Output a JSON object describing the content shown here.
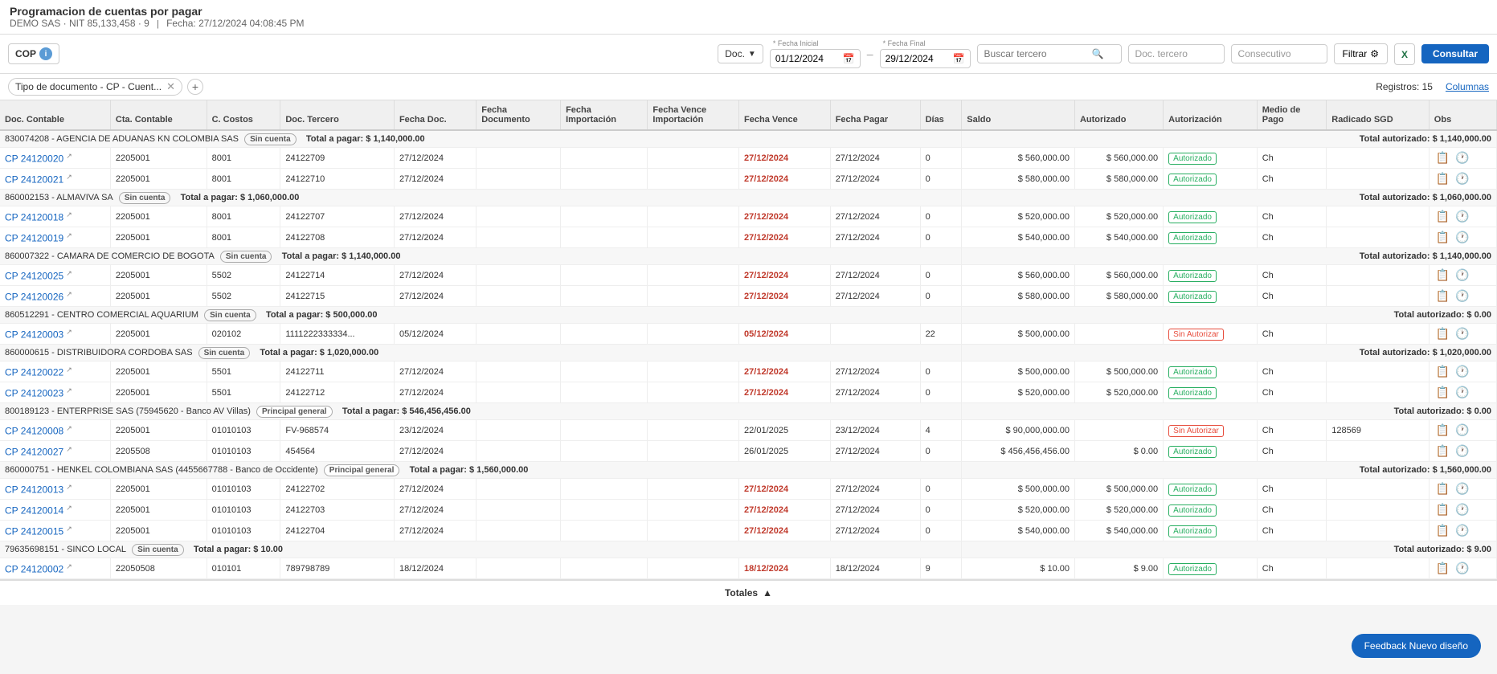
{
  "header": {
    "title": "Programacion de cuentas por pagar",
    "subtitle": "DEMO SAS · NIT 85,133,458 · 9",
    "date_info": "Fecha: 27/12/2024 04:08:45 PM"
  },
  "toolbar": {
    "currency": "COP",
    "doc_label": "Doc.",
    "fecha_inicial_label": "* Fecha Inicial",
    "fecha_inicial": "01/12/2024",
    "fecha_final_label": "* Fecha Final",
    "fecha_final": "29/12/2024",
    "buscar_placeholder": "Buscar tercero",
    "doc_tercero_placeholder": "Doc. tercero",
    "consecutivo_placeholder": "Consecutivo",
    "btn_filtrar": "Filtrar",
    "btn_consultar": "Consultar"
  },
  "filter_bar": {
    "tag": "Tipo de documento - CP - Cuent...",
    "registros": "Registros: 15",
    "btn_columnas": "Columnas"
  },
  "columns": [
    "Doc. Contable",
    "Cta. Contable",
    "C. Costos",
    "Doc. Tercero",
    "Fecha Doc.",
    "Fecha Documento",
    "Fecha Importación",
    "Fecha Vence Importación",
    "Fecha Vence",
    "Fecha Pagar",
    "Días",
    "Saldo",
    "Autorizado",
    "Autorización",
    "Medio de Pago",
    "Radicado SGD",
    "Obs"
  ],
  "groups": [
    {
      "id": "g1",
      "label": "830074208 - AGENCIA DE ADUANAS KN COLOMBIA SAS",
      "badge": "Sin cuenta",
      "total_pagar": "Total a pagar: $ 1,140,000.00",
      "total_autorizado": "Total autorizado: $ 1,140,000.00",
      "rows": [
        {
          "doc_contable": "CP 24120020",
          "cta_contable": "2205001",
          "c_costos": "8001",
          "doc_tercero": "24122709",
          "fecha_doc": "27/12/2024",
          "fecha_documento": "",
          "fecha_importacion": "",
          "fecha_vence_importacion": "",
          "fecha_vence": "27/12/2024",
          "fecha_vence_red": true,
          "fecha_pagar": "27/12/2024",
          "dias": "0",
          "saldo": "$ 560,000.00",
          "autorizado": "$ 560,000.00",
          "autorizacion": "Autorizado",
          "medio_pago": "Ch",
          "radicado_sgd": "",
          "obs": ""
        },
        {
          "doc_contable": "CP 24120021",
          "cta_contable": "2205001",
          "c_costos": "8001",
          "doc_tercero": "24122710",
          "fecha_doc": "27/12/2024",
          "fecha_documento": "",
          "fecha_importacion": "",
          "fecha_vence_importacion": "",
          "fecha_vence": "27/12/2024",
          "fecha_vence_red": true,
          "fecha_pagar": "27/12/2024",
          "dias": "0",
          "saldo": "$ 580,000.00",
          "autorizado": "$ 580,000.00",
          "autorizacion": "Autorizado",
          "medio_pago": "Ch",
          "radicado_sgd": "",
          "obs": ""
        }
      ]
    },
    {
      "id": "g2",
      "label": "860002153 - ALMAVIVA SA",
      "badge": "Sin cuenta",
      "total_pagar": "Total a pagar: $ 1,060,000.00",
      "total_autorizado": "Total autorizado: $ 1,060,000.00",
      "rows": [
        {
          "doc_contable": "CP 24120018",
          "cta_contable": "2205001",
          "c_costos": "8001",
          "doc_tercero": "24122707",
          "fecha_doc": "27/12/2024",
          "fecha_documento": "",
          "fecha_importacion": "",
          "fecha_vence_importacion": "",
          "fecha_vence": "27/12/2024",
          "fecha_vence_red": true,
          "fecha_pagar": "27/12/2024",
          "dias": "0",
          "saldo": "$ 520,000.00",
          "autorizado": "$ 520,000.00",
          "autorizacion": "Autorizado",
          "medio_pago": "Ch",
          "radicado_sgd": "",
          "obs": ""
        },
        {
          "doc_contable": "CP 24120019",
          "cta_contable": "2205001",
          "c_costos": "8001",
          "doc_tercero": "24122708",
          "fecha_doc": "27/12/2024",
          "fecha_documento": "",
          "fecha_importacion": "",
          "fecha_vence_importacion": "",
          "fecha_vence": "27/12/2024",
          "fecha_vence_red": true,
          "fecha_pagar": "27/12/2024",
          "dias": "0",
          "saldo": "$ 540,000.00",
          "autorizado": "$ 540,000.00",
          "autorizacion": "Autorizado",
          "medio_pago": "Ch",
          "radicado_sgd": "",
          "obs": ""
        }
      ]
    },
    {
      "id": "g3",
      "label": "860007322 - CAMARA DE COMERCIO DE BOGOTA",
      "badge": "Sin cuenta",
      "total_pagar": "Total a pagar: $ 1,140,000.00",
      "total_autorizado": "Total autorizado: $ 1,140,000.00",
      "rows": [
        {
          "doc_contable": "CP 24120025",
          "cta_contable": "2205001",
          "c_costos": "5502",
          "doc_tercero": "24122714",
          "fecha_doc": "27/12/2024",
          "fecha_documento": "",
          "fecha_importacion": "",
          "fecha_vence_importacion": "",
          "fecha_vence": "27/12/2024",
          "fecha_vence_red": true,
          "fecha_pagar": "27/12/2024",
          "dias": "0",
          "saldo": "$ 560,000.00",
          "autorizado": "$ 560,000.00",
          "autorizacion": "Autorizado",
          "medio_pago": "Ch",
          "radicado_sgd": "",
          "obs": ""
        },
        {
          "doc_contable": "CP 24120026",
          "cta_contable": "2205001",
          "c_costos": "5502",
          "doc_tercero": "24122715",
          "fecha_doc": "27/12/2024",
          "fecha_documento": "",
          "fecha_importacion": "",
          "fecha_vence_importacion": "",
          "fecha_vence": "27/12/2024",
          "fecha_vence_red": true,
          "fecha_pagar": "27/12/2024",
          "dias": "0",
          "saldo": "$ 580,000.00",
          "autorizado": "$ 580,000.00",
          "autorizacion": "Autorizado",
          "medio_pago": "Ch",
          "radicado_sgd": "",
          "obs": ""
        }
      ]
    },
    {
      "id": "g4",
      "label": "860512291 - CENTRO COMERCIAL AQUARIUM",
      "badge": "Sin cuenta",
      "total_pagar": "Total a pagar: $ 500,000.00",
      "total_autorizado": "Total autorizado: $ 0.00",
      "rows": [
        {
          "doc_contable": "CP 24120003",
          "cta_contable": "2205001",
          "c_costos": "020102",
          "doc_tercero": "1111222333334...",
          "fecha_doc": "05/12/2024",
          "fecha_documento": "",
          "fecha_importacion": "",
          "fecha_vence_importacion": "",
          "fecha_vence": "05/12/2024",
          "fecha_vence_red": true,
          "fecha_pagar": "",
          "dias": "22",
          "saldo": "$ 500,000.00",
          "autorizado": "",
          "autorizacion": "Sin Autorizar",
          "medio_pago": "Ch",
          "radicado_sgd": "",
          "obs": ""
        }
      ]
    },
    {
      "id": "g5",
      "label": "860000615 - DISTRIBUIDORA CORDOBA SAS",
      "badge": "Sin cuenta",
      "total_pagar": "Total a pagar: $ 1,020,000.00",
      "total_autorizado": "Total autorizado: $ 1,020,000.00",
      "rows": [
        {
          "doc_contable": "CP 24120022",
          "cta_contable": "2205001",
          "c_costos": "5501",
          "doc_tercero": "24122711",
          "fecha_doc": "27/12/2024",
          "fecha_documento": "",
          "fecha_importacion": "",
          "fecha_vence_importacion": "",
          "fecha_vence": "27/12/2024",
          "fecha_vence_red": true,
          "fecha_pagar": "27/12/2024",
          "dias": "0",
          "saldo": "$ 500,000.00",
          "autorizado": "$ 500,000.00",
          "autorizacion": "Autorizado",
          "medio_pago": "Ch",
          "radicado_sgd": "",
          "obs": ""
        },
        {
          "doc_contable": "CP 24120023",
          "cta_contable": "2205001",
          "c_costos": "5501",
          "doc_tercero": "24122712",
          "fecha_doc": "27/12/2024",
          "fecha_documento": "",
          "fecha_importacion": "",
          "fecha_vence_importacion": "",
          "fecha_vence": "27/12/2024",
          "fecha_vence_red": true,
          "fecha_pagar": "27/12/2024",
          "dias": "0",
          "saldo": "$ 520,000.00",
          "autorizado": "$ 520,000.00",
          "autorizacion": "Autorizado",
          "medio_pago": "Ch",
          "radicado_sgd": "",
          "obs": ""
        }
      ]
    },
    {
      "id": "g6",
      "label": "800189123 - ENTERPRISE SAS (75945620 - Banco AV Villas)",
      "badge": "Principal general",
      "total_pagar": "Total a pagar: $ 546,456,456.00",
      "total_autorizado": "Total autorizado: $ 0.00",
      "rows": [
        {
          "doc_contable": "CP 24120008",
          "cta_contable": "2205001",
          "c_costos": "01010103",
          "doc_tercero": "FV-968574",
          "fecha_doc": "23/12/2024",
          "fecha_documento": "",
          "fecha_importacion": "",
          "fecha_vence_importacion": "",
          "fecha_vence": "22/01/2025",
          "fecha_vence_red": false,
          "fecha_pagar": "23/12/2024",
          "dias": "4",
          "saldo": "$ 90,000,000.00",
          "autorizado": "",
          "autorizacion": "Sin Autorizar",
          "medio_pago": "Ch",
          "radicado_sgd": "128569",
          "obs": ""
        },
        {
          "doc_contable": "CP 24120027",
          "cta_contable": "2205508",
          "c_costos": "01010103",
          "doc_tercero": "454564",
          "fecha_doc": "27/12/2024",
          "fecha_documento": "",
          "fecha_importacion": "",
          "fecha_vence_importacion": "",
          "fecha_vence": "26/01/2025",
          "fecha_vence_red": false,
          "fecha_pagar": "27/12/2024",
          "dias": "0",
          "saldo": "$ 456,456,456.00",
          "autorizado": "$ 0.00",
          "autorizacion": "Autorizado",
          "medio_pago": "Ch",
          "radicado_sgd": "",
          "obs": ""
        }
      ]
    },
    {
      "id": "g7",
      "label": "860000751 - HENKEL COLOMBIANA SAS (4455667788 - Banco de Occidente)",
      "badge": "Principal general",
      "total_pagar": "Total a pagar: $ 1,560,000.00",
      "total_autorizado": "Total autorizado: $ 1,560,000.00",
      "rows": [
        {
          "doc_contable": "CP 24120013",
          "cta_contable": "2205001",
          "c_costos": "01010103",
          "doc_tercero": "24122702",
          "fecha_doc": "27/12/2024",
          "fecha_documento": "",
          "fecha_importacion": "",
          "fecha_vence_importacion": "",
          "fecha_vence": "27/12/2024",
          "fecha_vence_red": true,
          "fecha_pagar": "27/12/2024",
          "dias": "0",
          "saldo": "$ 500,000.00",
          "autorizado": "$ 500,000.00",
          "autorizacion": "Autorizado",
          "medio_pago": "Ch",
          "radicado_sgd": "",
          "obs": ""
        },
        {
          "doc_contable": "CP 24120014",
          "cta_contable": "2205001",
          "c_costos": "01010103",
          "doc_tercero": "24122703",
          "fecha_doc": "27/12/2024",
          "fecha_documento": "",
          "fecha_importacion": "",
          "fecha_vence_importacion": "",
          "fecha_vence": "27/12/2024",
          "fecha_vence_red": true,
          "fecha_pagar": "27/12/2024",
          "dias": "0",
          "saldo": "$ 520,000.00",
          "autorizado": "$ 520,000.00",
          "autorizacion": "Autorizado",
          "medio_pago": "Ch",
          "radicado_sgd": "",
          "obs": ""
        },
        {
          "doc_contable": "CP 24120015",
          "cta_contable": "2205001",
          "c_costos": "01010103",
          "doc_tercero": "24122704",
          "fecha_doc": "27/12/2024",
          "fecha_documento": "",
          "fecha_importacion": "",
          "fecha_vence_importacion": "",
          "fecha_vence": "27/12/2024",
          "fecha_vence_red": true,
          "fecha_pagar": "27/12/2024",
          "dias": "0",
          "saldo": "$ 540,000.00",
          "autorizado": "$ 540,000.00",
          "autorizacion": "Autorizado",
          "medio_pago": "Ch",
          "radicado_sgd": "",
          "obs": ""
        }
      ]
    },
    {
      "id": "g8",
      "label": "79635698151 - SINCO LOCAL",
      "badge": "Sin cuenta",
      "total_pagar": "Total a pagar: $ 10.00",
      "total_autorizado": "Total autorizado: $ 9.00",
      "rows": [
        {
          "doc_contable": "CP 24120002",
          "cta_contable": "22050508",
          "c_costos": "010101",
          "doc_tercero": "789798789",
          "fecha_doc": "18/12/2024",
          "fecha_documento": "",
          "fecha_importacion": "",
          "fecha_vence_importacion": "",
          "fecha_vence": "18/12/2024",
          "fecha_vence_red": true,
          "fecha_pagar": "18/12/2024",
          "dias": "9",
          "saldo": "$ 10.00",
          "autorizado": "$ 9.00",
          "autorizacion": "Autorizado",
          "medio_pago": "Ch",
          "radicado_sgd": "",
          "obs": ""
        }
      ]
    }
  ],
  "footer": {
    "totales_label": "Totales",
    "chevron": "▲"
  },
  "feedback_btn": "Feedback Nuevo diseño"
}
